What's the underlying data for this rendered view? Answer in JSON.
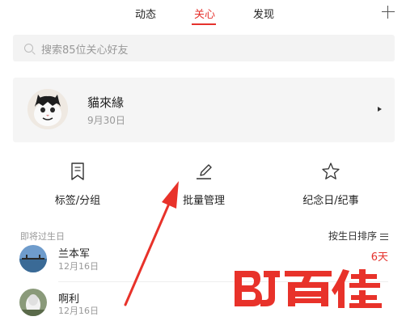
{
  "tabs": [
    {
      "label": "动态",
      "active": false
    },
    {
      "label": "关心",
      "active": true
    },
    {
      "label": "发现",
      "active": false
    }
  ],
  "accent_color": "#e5322d",
  "header": {
    "add_icon": "plus-icon"
  },
  "search": {
    "placeholder": "搜索85位关心好友",
    "icon": "search-icon"
  },
  "contact_card": {
    "name": "貓來緣",
    "date": "9月30日"
  },
  "features": [
    {
      "label": "标签/分组",
      "icon": "bookmark-icon"
    },
    {
      "label": "批量管理",
      "icon": "pencil-icon"
    },
    {
      "label": "纪念日/纪事",
      "icon": "star-icon"
    }
  ],
  "birthday_section": {
    "title": "即将过生日",
    "sort_label": "按生日排序",
    "people": [
      {
        "name": "兰本军",
        "date": "12月16日",
        "badge": "6天"
      },
      {
        "name": "啊利",
        "date": "12月16日",
        "badge": ""
      }
    ]
  },
  "watermark": {
    "text": "百佳"
  }
}
